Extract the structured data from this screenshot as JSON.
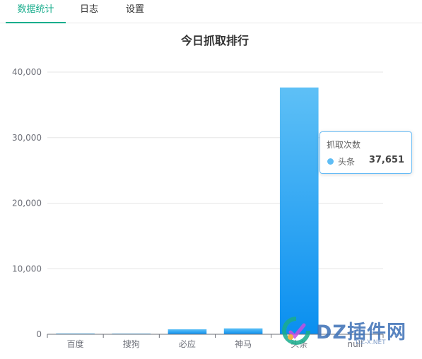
{
  "tabs": [
    {
      "label": "数据统计",
      "active": true
    },
    {
      "label": "日志",
      "active": false
    },
    {
      "label": "设置",
      "active": false
    }
  ],
  "accent_color": "#1aad8d",
  "chart_data": {
    "type": "bar",
    "title": "今日抓取排行",
    "categories": [
      "百度",
      "搜狗",
      "必应",
      "神马",
      "头条",
      "null"
    ],
    "series": [
      {
        "name": "抓取次数",
        "values": [
          120,
          30,
          760,
          900,
          37651,
          0
        ]
      }
    ],
    "ylim": [
      0,
      40000
    ],
    "y_ticks": [
      "0",
      "10,000",
      "20,000",
      "30,000",
      "40,000"
    ],
    "grid": true,
    "bar_gradient": [
      "#5ec0f6",
      "#0a8ff0"
    ]
  },
  "tooltip": {
    "title": "抓取次数",
    "name": "头条",
    "value": "37,651"
  },
  "watermark": {
    "text": "DZ插件网",
    "sub": "DZ-X.NET"
  }
}
